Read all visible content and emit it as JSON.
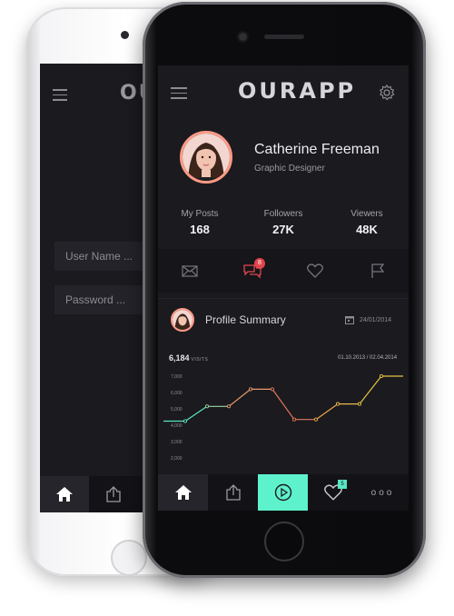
{
  "app": {
    "name": "OURAPP"
  },
  "login": {
    "username_placeholder": "User Name ...",
    "password_placeholder": "Password ..."
  },
  "profile": {
    "name": "Catherine Freeman",
    "role": "Graphic Designer",
    "stats": [
      {
        "label": "My Posts",
        "value": "168"
      },
      {
        "label": "Followers",
        "value": "27K"
      },
      {
        "label": "Viewers",
        "value": "48K"
      }
    ]
  },
  "action_bar": {
    "items": [
      "mail-icon",
      "comments-icon",
      "heart-icon",
      "flag-icon"
    ],
    "comments_badge": "8"
  },
  "summary": {
    "title": "Profile Summary",
    "date": "24/01/2014",
    "visits_value": "6,184",
    "visits_label": "VISITS",
    "date_range": "01.10.2013 / 02.04.2014"
  },
  "chart_data": {
    "type": "line",
    "ylim": [
      1500,
      7500
    ],
    "yticks": [
      "7,000",
      "6,000",
      "5,000",
      "4,000",
      "3,000",
      "2,000"
    ],
    "ytick_values": [
      7000,
      6000,
      5000,
      4000,
      3000,
      2000
    ],
    "series": [
      {
        "values": [
          4250,
          4250,
          5150,
          5150,
          6200,
          6200,
          4350,
          4350,
          5300,
          5300,
          7000,
          7000
        ]
      }
    ],
    "colors": [
      "#58e7c2",
      "#58e7c2",
      "#9bd4a0",
      "#e79a6a",
      "#e79a6a",
      "#e0795a",
      "#e0795a",
      "#e8a84d",
      "#e8b84a",
      "#e6c440",
      "#e6c440"
    ]
  },
  "tabbar": {
    "items": [
      "home-icon",
      "share-icon",
      "play-icon",
      "heart-icon",
      "more-icon"
    ],
    "likes_badge": "5",
    "more_label": "ooo"
  },
  "colors": {
    "accent": "#5ef2cc",
    "avatar_ring": "#ff9a86",
    "badge": "#e0454d",
    "screen_bg": "#1b1a1f"
  }
}
